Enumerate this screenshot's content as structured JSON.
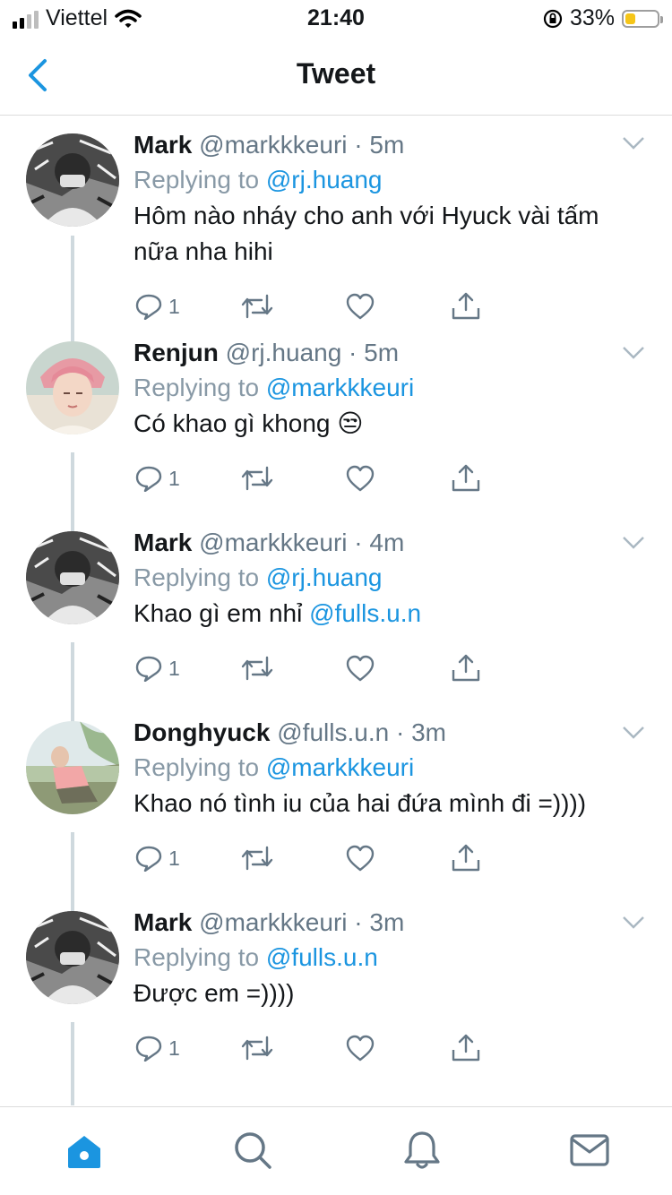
{
  "status_bar": {
    "carrier": "Viettel",
    "time": "21:40",
    "battery_percent": "33%",
    "battery_level": 0.33,
    "signal_bars_on": 2,
    "signal_bars_total": 4
  },
  "header": {
    "title": "Tweet"
  },
  "colors": {
    "accent": "#1b95e0",
    "muted": "#657786",
    "thread_line": "#cfd9de"
  },
  "tweets": [
    {
      "name": "Mark",
      "handle": "@markkkeuri",
      "time": "5m",
      "replying_prefix": "Replying to ",
      "replying_to": "@rj.huang",
      "text": "Hôm nào nháy cho anh với Hyuck vài tấm nữa nha hihi",
      "reply_count": "1",
      "avatar": "avatar-mark"
    },
    {
      "name": "Renjun",
      "handle": "@rj.huang",
      "time": "5m",
      "replying_prefix": "Replying to ",
      "replying_to": "@markkkeuri",
      "text": "Có khao gì khong",
      "emoji": "😒",
      "reply_count": "1",
      "avatar": "avatar-renjun"
    },
    {
      "name": "Mark",
      "handle": "@markkkeuri",
      "time": "4m",
      "replying_prefix": "Replying to ",
      "replying_to": "@rj.huang",
      "text": "Khao gì em nhỉ ",
      "mention": "@fulls.u.n",
      "reply_count": "1",
      "avatar": "avatar-mark"
    },
    {
      "name": "Donghyuck",
      "handle": "@fulls.u.n",
      "time": "3m",
      "replying_prefix": "Replying to ",
      "replying_to": "@markkkeuri",
      "text": "Khao nó tình iu của hai đứa mình đi =))))",
      "reply_count": "1",
      "avatar": "avatar-donghyuck"
    },
    {
      "name": "Mark",
      "handle": "@markkkeuri",
      "time": "3m",
      "replying_prefix": "Replying to ",
      "replying_to": "@fulls.u.n",
      "text": "Được em =))))",
      "reply_count": "1",
      "avatar": "avatar-mark"
    }
  ],
  "tab_bar": {
    "items": [
      "home-icon",
      "search-icon",
      "notifications-icon",
      "messages-icon"
    ],
    "active": "home-icon"
  }
}
